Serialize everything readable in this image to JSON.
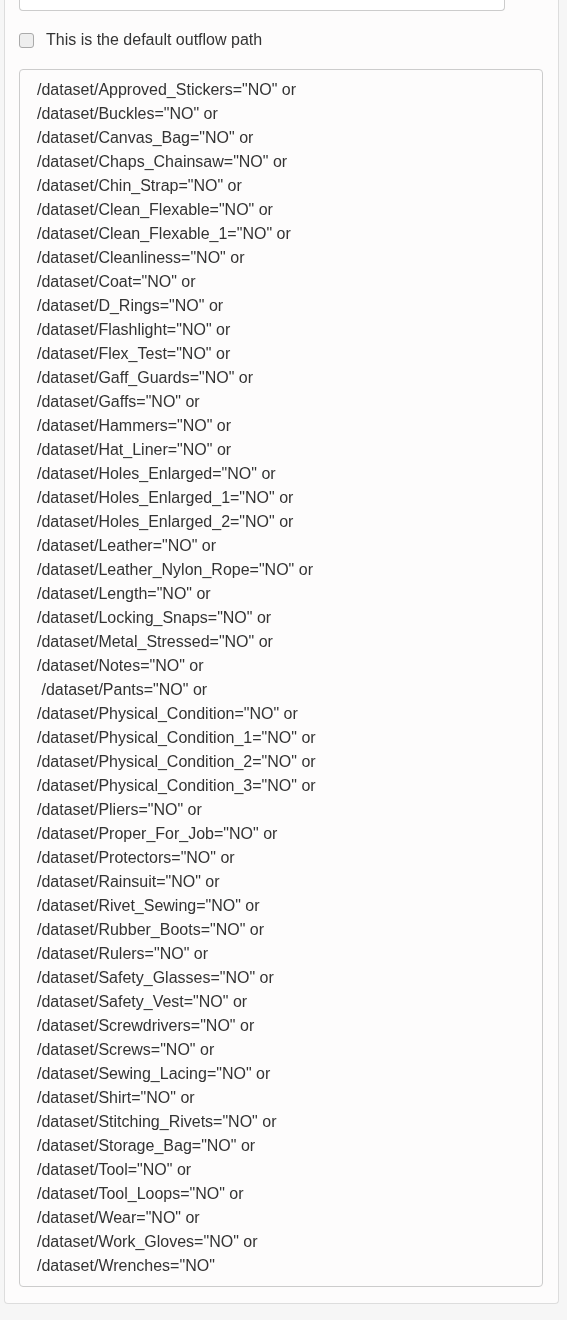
{
  "default_outflow": {
    "label": "This is the default outflow path",
    "checked": false
  },
  "expression_lines": [
    "/dataset/Approved_Stickers=\"NO\" or",
    "/dataset/Buckles=\"NO\" or",
    "/dataset/Canvas_Bag=\"NO\" or",
    "/dataset/Chaps_Chainsaw=\"NO\" or",
    "/dataset/Chin_Strap=\"NO\" or",
    "/dataset/Clean_Flexable=\"NO\" or",
    "/dataset/Clean_Flexable_1=\"NO\" or",
    "/dataset/Cleanliness=\"NO\" or",
    "/dataset/Coat=\"NO\" or",
    "/dataset/D_Rings=\"NO\" or",
    "/dataset/Flashlight=\"NO\" or",
    "/dataset/Flex_Test=\"NO\" or",
    "/dataset/Gaff_Guards=\"NO\" or",
    "/dataset/Gaffs=\"NO\" or",
    "/dataset/Hammers=\"NO\" or",
    "/dataset/Hat_Liner=\"NO\" or",
    "/dataset/Holes_Enlarged=\"NO\" or",
    "/dataset/Holes_Enlarged_1=\"NO\" or",
    "/dataset/Holes_Enlarged_2=\"NO\" or",
    "/dataset/Leather=\"NO\" or",
    "/dataset/Leather_Nylon_Rope=\"NO\" or",
    "/dataset/Length=\"NO\" or",
    "/dataset/Locking_Snaps=\"NO\" or",
    "/dataset/Metal_Stressed=\"NO\" or",
    "/dataset/Notes=\"NO\" or",
    " /dataset/Pants=\"NO\" or",
    "/dataset/Physical_Condition=\"NO\" or",
    "/dataset/Physical_Condition_1=\"NO\" or",
    "/dataset/Physical_Condition_2=\"NO\" or",
    "/dataset/Physical_Condition_3=\"NO\" or",
    "/dataset/Pliers=\"NO\" or",
    "/dataset/Proper_For_Job=\"NO\" or",
    "/dataset/Protectors=\"NO\" or",
    "/dataset/Rainsuit=\"NO\" or",
    "/dataset/Rivet_Sewing=\"NO\" or",
    "/dataset/Rubber_Boots=\"NO\" or",
    "/dataset/Rulers=\"NO\" or",
    "/dataset/Safety_Glasses=\"NO\" or",
    "/dataset/Safety_Vest=\"NO\" or",
    "/dataset/Screwdrivers=\"NO\" or",
    "/dataset/Screws=\"NO\" or",
    "/dataset/Sewing_Lacing=\"NO\" or",
    "/dataset/Shirt=\"NO\" or",
    "/dataset/Stitching_Rivets=\"NO\" or",
    "/dataset/Storage_Bag=\"NO\" or",
    "/dataset/Tool=\"NO\" or",
    "/dataset/Tool_Loops=\"NO\" or",
    "/dataset/Wear=\"NO\" or",
    "/dataset/Work_Gloves=\"NO\" or",
    "/dataset/Wrenches=\"NO\""
  ]
}
